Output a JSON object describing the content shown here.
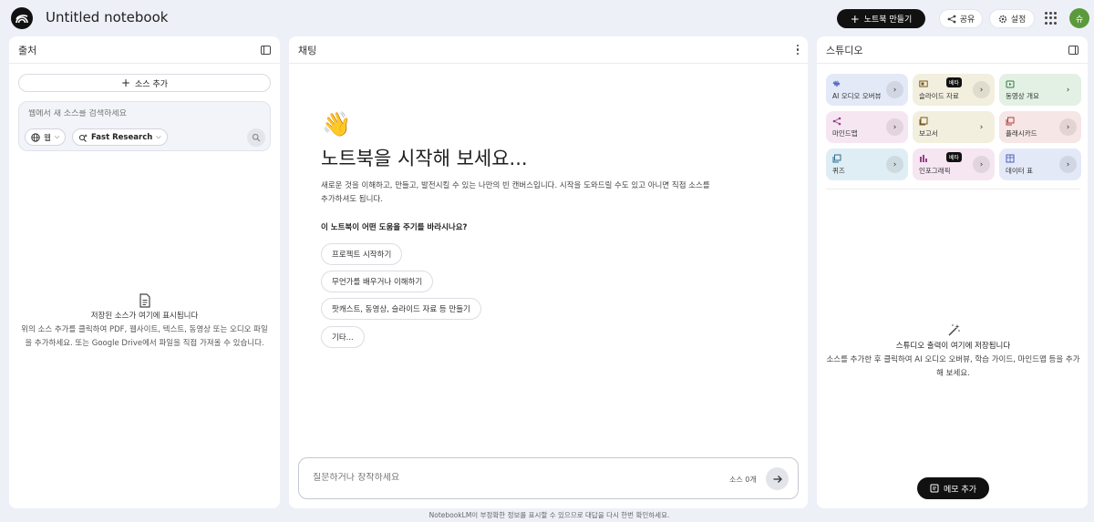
{
  "header": {
    "title": "Untitled notebook",
    "create_label": "노트북 만들기",
    "share_label": "공유",
    "settings_label": "설정",
    "avatar_initial": "슈"
  },
  "sources": {
    "title": "출처",
    "add_label": "소스 추가",
    "search_placeholder": "웹에서 새 소스를 검색하세요",
    "web_chip": "웹",
    "research_chip": "Fast Research",
    "empty_title": "저장된 소스가 여기에 표시됩니다",
    "empty_desc": "위의 소스 추가를 클릭하여 PDF, 웹사이트, 텍스트, 동영상 또는 오디오 파일을 추가하세요. 또는 Google Drive에서 파일을 직접 가져올 수 있습니다."
  },
  "chat": {
    "title": "채팅",
    "heading": "노트북을 시작해 보세요...",
    "desc": "새로운 것을 이해하고, 만들고, 발전시킬 수 있는 나만의 빈 캔버스입니다. 시작을 도와드릴 수도 있고 아니면 직접 소스를 추가하셔도 됩니다.",
    "question": "이 노트북이 어떤 도움을 주기를 바라시나요?",
    "suggestions": [
      "프로젝트 시작하기",
      "무언가를 배우거나 이해하기",
      "팟캐스트, 동영상, 슬라이드 자료 등 만들기",
      "기타..."
    ],
    "input_placeholder": "질문하거나 창작하세요",
    "source_count": "소스 0개"
  },
  "footer": "NotebookLM이 부정확한 정보를 표시할 수 있으므로 대답을 다시 한번 확인하세요.",
  "studio": {
    "title": "스튜디오",
    "tiles": [
      {
        "label": "AI 오디오 오버뷰",
        "bg": "#e4e9f7",
        "accent": "#4a5fc1",
        "badge": ""
      },
      {
        "label": "슬라이드 자료",
        "bg": "#f2efdf",
        "accent": "#7a5a1a",
        "badge": "베타"
      },
      {
        "label": "동영상 개요",
        "bg": "#e2f1e4",
        "accent": "#2d7a3a",
        "badge": ""
      },
      {
        "label": "마인드맵",
        "bg": "#f5e6f2",
        "accent": "#9a3c8a",
        "badge": ""
      },
      {
        "label": "보고서",
        "bg": "#f2efdf",
        "accent": "#7a5a1a",
        "badge": ""
      },
      {
        "label": "플래시카드",
        "bg": "#f7e6e6",
        "accent": "#b33a3a",
        "badge": ""
      },
      {
        "label": "퀴즈",
        "bg": "#dfeef4",
        "accent": "#2a6f8f",
        "badge": ""
      },
      {
        "label": "인포그래픽",
        "bg": "#f5e6f2",
        "accent": "#9a3c8a",
        "badge": "베타"
      },
      {
        "label": "데이터 표",
        "bg": "#e4e9f7",
        "accent": "#4a5fc1",
        "badge": ""
      }
    ],
    "empty_title": "스튜디오 출력이 여기에 저장됩니다",
    "empty_desc": "소스를 추가한 후 클릭하여 AI 오디오 오버뷰, 학습 가이드, 마인드맵 등을 추가해 보세요.",
    "memo_label": "메모 추가"
  }
}
